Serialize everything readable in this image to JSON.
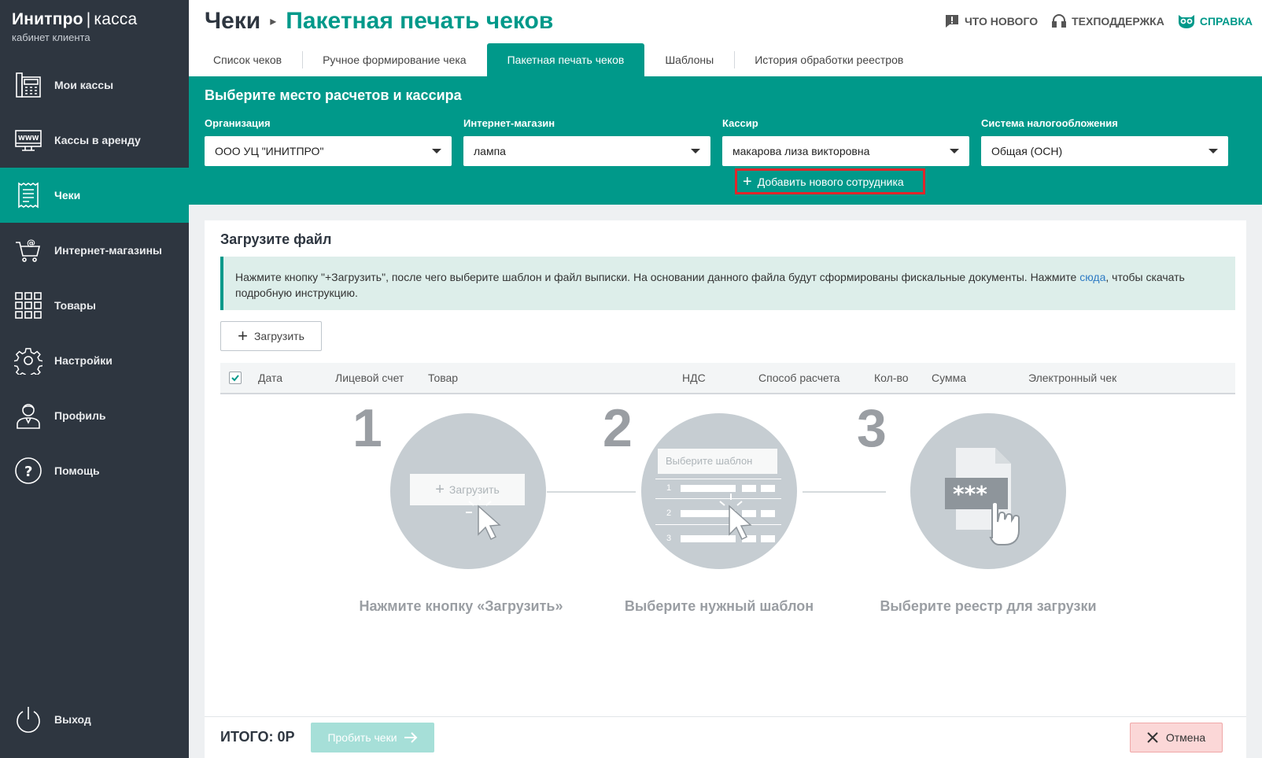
{
  "brand": {
    "name": "Инитпро",
    "separator": "|",
    "product": "касса",
    "subtitle": "кабинет клиента"
  },
  "sidebar": {
    "items": [
      {
        "label": "Мои кассы",
        "icon": "cash-register-icon"
      },
      {
        "label": "Кассы в аренду",
        "icon": "www-monitor-icon"
      },
      {
        "label": "Чеки",
        "icon": "receipt-icon",
        "active": true
      },
      {
        "label": "Интернет-магазины",
        "icon": "shopping-cart-icon"
      },
      {
        "label": "Товары",
        "icon": "grid-icon"
      },
      {
        "label": "Настройки",
        "icon": "gear-icon"
      },
      {
        "label": "Профиль",
        "icon": "user-icon"
      },
      {
        "label": "Помощь",
        "icon": "help-icon"
      }
    ],
    "exit": {
      "label": "Выход",
      "icon": "power-icon"
    }
  },
  "header": {
    "breadcrumb_root": "Чеки",
    "breadcrumb_current": "Пакетная печать чеков",
    "links": {
      "whats_new": "Что нового",
      "support": "Техподдержка",
      "help": "Справка"
    }
  },
  "tabs": [
    {
      "label": "Список чеков"
    },
    {
      "label": "Ручное формирование чека"
    },
    {
      "label": "Пакетная печать чеков",
      "active": true
    },
    {
      "label": "Шаблоны"
    },
    {
      "label": "История обработки реестров"
    }
  ],
  "filters": {
    "title": "Выберите место расчетов и кассира",
    "organization": {
      "label": "Организация",
      "value": "ООО УЦ \"ИНИТПРО\""
    },
    "shop": {
      "label": "Интернет-магазин",
      "value": "лампа"
    },
    "cashier": {
      "label": "Кассир",
      "value": "макарова лиза викторовна"
    },
    "tax": {
      "label": "Система налогообложения",
      "value": "Общая (ОСН)"
    },
    "add_employee": "Добавить нового сотрудника"
  },
  "upload": {
    "title": "Загрузите файл",
    "info_before": "Нажмите кнопку \"+Загрузить\", после чего выберите шаблон и файл выписки. На основании данного файла будут сформированы фискальные документы. Нажмите ",
    "info_link": "сюда",
    "info_after": ", чтобы скачать подробную инструкцию.",
    "button": "Загрузить"
  },
  "table": {
    "columns": [
      "Дата",
      "Лицевой счет",
      "Товар",
      "НДС",
      "Способ расчета",
      "Кол-во",
      "Сумма",
      "Электронный чек"
    ]
  },
  "steps": [
    {
      "number": "1",
      "label": "Нажмите кнопку «Загрузить»",
      "illustration_text": "Загрузить"
    },
    {
      "number": "2",
      "label": "Выберите нужный шаблон",
      "illustration_text": "Выберите шаблон",
      "rows": [
        "1",
        "2",
        "3"
      ]
    },
    {
      "number": "3",
      "label": "Выберите реестр для загрузки",
      "illustration_text": "***"
    }
  ],
  "footer": {
    "total": "ИТОГО: 0Р",
    "punch": "Пробить чеки",
    "cancel": "Отмена"
  },
  "colors": {
    "accent": "#00998a",
    "sidebar": "#2e3640",
    "highlight": "#e0262a"
  }
}
